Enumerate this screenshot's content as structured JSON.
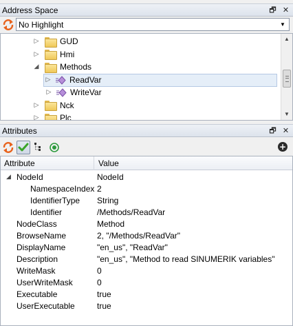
{
  "address_space": {
    "title": "Address Space",
    "restore_glyph": "🗗",
    "close_glyph": "✕",
    "highlight_combo": {
      "value": "No Highlight"
    },
    "tree": [
      {
        "label": "GUD",
        "icon": "folder-icon",
        "expander": "▷",
        "expanded": false,
        "selected": false
      },
      {
        "label": "Hmi",
        "icon": "folder-icon",
        "expander": "▷",
        "expanded": false,
        "selected": false
      },
      {
        "label": "Methods",
        "icon": "folder-icon",
        "expander": "◢",
        "expanded": true,
        "selected": false
      },
      {
        "label": "ReadVar",
        "icon": "method-icon",
        "expander": "▷",
        "expanded": false,
        "selected": true
      },
      {
        "label": "WriteVar",
        "icon": "method-icon",
        "expander": "▷",
        "expanded": false,
        "selected": false
      },
      {
        "label": "Nck",
        "icon": "folder-icon",
        "expander": "▷",
        "expanded": false,
        "selected": false
      },
      {
        "label": "Plc",
        "icon": "folder-icon",
        "expander": "▷",
        "expanded": false,
        "selected": false
      }
    ]
  },
  "attributes": {
    "title": "Attributes",
    "restore_glyph": "🗗",
    "close_glyph": "✕",
    "add_glyph": "+",
    "columns": {
      "attribute": "Attribute",
      "value": "Value"
    },
    "rows": [
      {
        "attribute": "NodeId",
        "value": "NodeId",
        "expander": "◢"
      },
      {
        "attribute": "NamespaceIndex",
        "value": "2"
      },
      {
        "attribute": "IdentifierType",
        "value": "String"
      },
      {
        "attribute": "Identifier",
        "value": "/Methods/ReadVar"
      },
      {
        "attribute": "NodeClass",
        "value": "Method"
      },
      {
        "attribute": "BrowseName",
        "value": "2, \"/Methods/ReadVar\""
      },
      {
        "attribute": "DisplayName",
        "value": "\"en_us\", \"ReadVar\""
      },
      {
        "attribute": "Description",
        "value": "\"en_us\", \"Method to read SINUMERIK variables\""
      },
      {
        "attribute": "WriteMask",
        "value": "0"
      },
      {
        "attribute": "UserWriteMask",
        "value": "0"
      },
      {
        "attribute": "Executable",
        "value": "true"
      },
      {
        "attribute": "UserExecutable",
        "value": "true"
      }
    ]
  },
  "colors": {
    "accent_orange": "#e8621c",
    "check_green": "#3aa52a",
    "selection": "#e5eef8"
  }
}
